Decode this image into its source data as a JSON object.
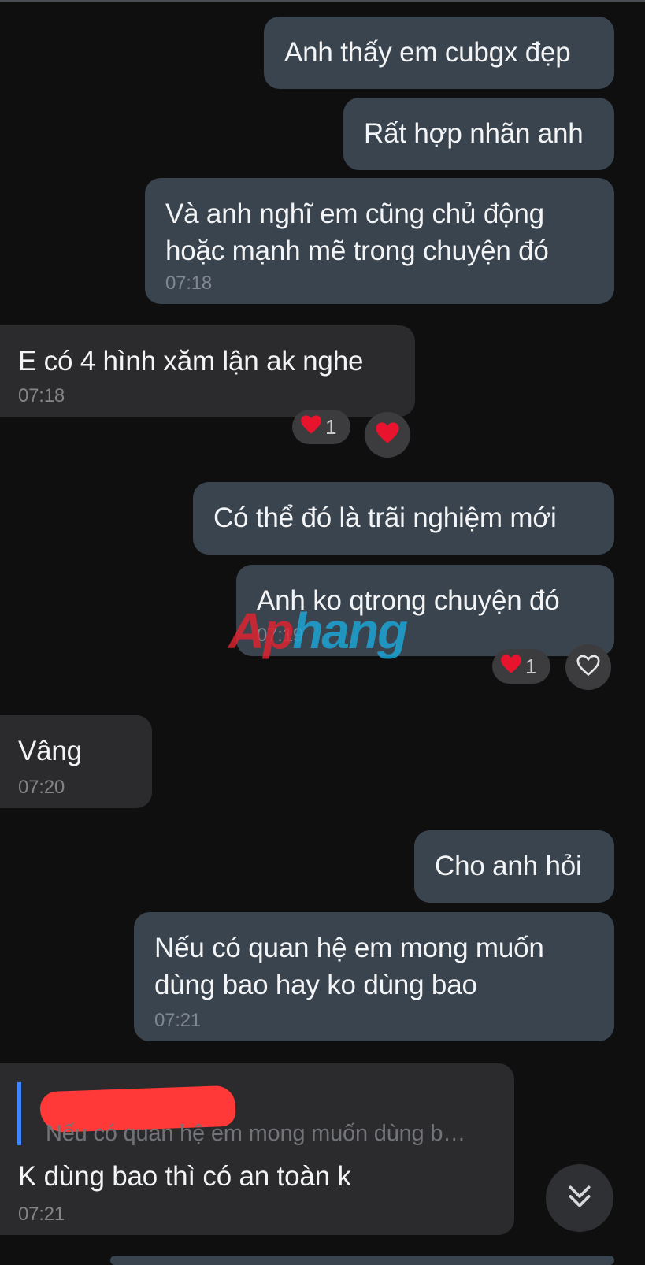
{
  "messages": [
    {
      "text": "Anh thấy em cubgx đẹp"
    },
    {
      "text": "Rất hợp nhãn anh"
    },
    {
      "line1": "Và anh nghĩ em cũng chủ động",
      "line2": "hoặc mạnh mẽ trong chuyện đó",
      "time": "07:18"
    },
    {
      "text": "E có 4 hình xăm lận ak nghe",
      "time": "07:18",
      "reaction_count": "1"
    },
    {
      "text": "Có thể đó là trãi nghiệm mới"
    },
    {
      "text": "Anh ko qtrong chuyện đó",
      "time": "07:19",
      "reaction_count": "1"
    },
    {
      "text": "Vâng",
      "time": "07:20"
    },
    {
      "text": "Cho anh hỏi"
    },
    {
      "line1": "Nếu có quan hệ em mong muốn",
      "line2": "dùng bao hay ko dùng bao",
      "time": "07:21"
    },
    {
      "reply_snippet": "Nếu có quan hệ em mong muốn dùng b…",
      "text": "K dùng bao thì có an toàn k",
      "time": "07:21"
    }
  ],
  "watermark": {
    "part1": "Ap",
    "part2": "hang"
  },
  "colors": {
    "outgoing": "#3a444f",
    "incoming": "#2b2b2d",
    "background": "#0f0f10",
    "heart": "#e8132c",
    "reply_bar": "#3d86ff",
    "redaction": "#ff3838"
  },
  "icons": {
    "reaction": "heart-icon",
    "react_button": "heart-outline-icon",
    "scroll": "double-chevron-down-icon"
  }
}
